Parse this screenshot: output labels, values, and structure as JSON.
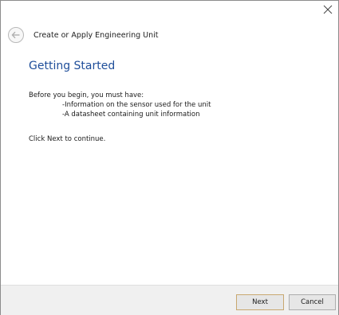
{
  "dialog": {
    "title": "Create or Apply Engineering Unit",
    "close_glyph": "×"
  },
  "content": {
    "heading": "Getting Started",
    "intro": "Before you begin, you must have:",
    "requirements": [
      "-Information on the sensor used for the unit",
      "-A datasheet containing unit information"
    ],
    "instruction": "Click Next to continue."
  },
  "footer": {
    "next_label": "Next",
    "cancel_label": "Cancel"
  },
  "icons": {
    "back": "back-arrow-icon",
    "close": "close-icon"
  },
  "colors": {
    "heading": "#1f4e9a",
    "footer_bg": "#f0f0f0",
    "next_border": "#c8a870"
  }
}
